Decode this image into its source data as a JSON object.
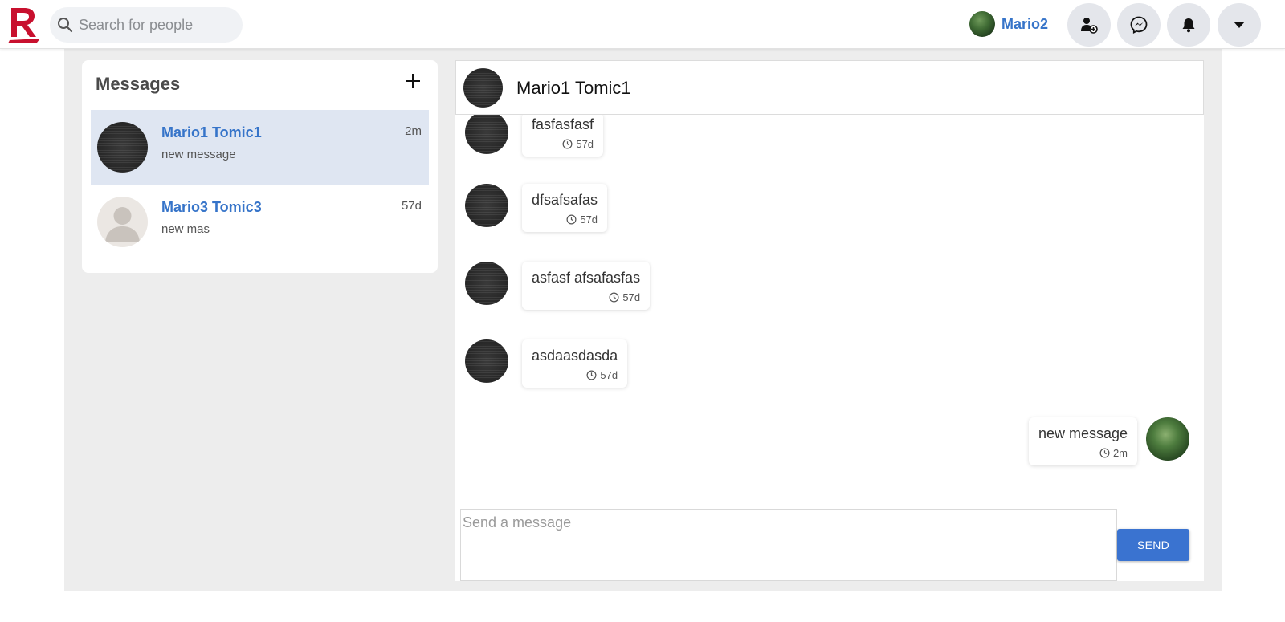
{
  "header": {
    "search_placeholder": "Search for people",
    "user_name": "Mario2",
    "icons": [
      "logo",
      "search-icon",
      "friend-requests-icon",
      "messenger-icon",
      "bell-icon",
      "caret-down-icon"
    ]
  },
  "sidebar": {
    "title": "Messages",
    "conversations": [
      {
        "name": "Mario1 Tomic1",
        "preview": "new message",
        "time": "2m",
        "active": true
      },
      {
        "name": "Mario3 Tomic3",
        "preview": "new mas",
        "time": "57d",
        "active": false
      }
    ]
  },
  "chat": {
    "title": "Mario1 Tomic1",
    "messages": [
      {
        "text": "fasfasfasf",
        "time": "57d",
        "direction": "in"
      },
      {
        "text": "dfsafsafas",
        "time": "57d",
        "direction": "in"
      },
      {
        "text": "asfasf afsafasfas",
        "time": "57d",
        "direction": "in"
      },
      {
        "text": "asdaasdasda",
        "time": "57d",
        "direction": "in"
      },
      {
        "text": "new message",
        "time": "2m",
        "direction": "out"
      }
    ]
  },
  "composer": {
    "placeholder": "Send a message",
    "send_label": "SEND"
  },
  "colors": {
    "accent": "#3674c9",
    "send_button": "#3a73d0",
    "active_conversation": "#dfe6f2",
    "logo_red": "#c8102e"
  }
}
